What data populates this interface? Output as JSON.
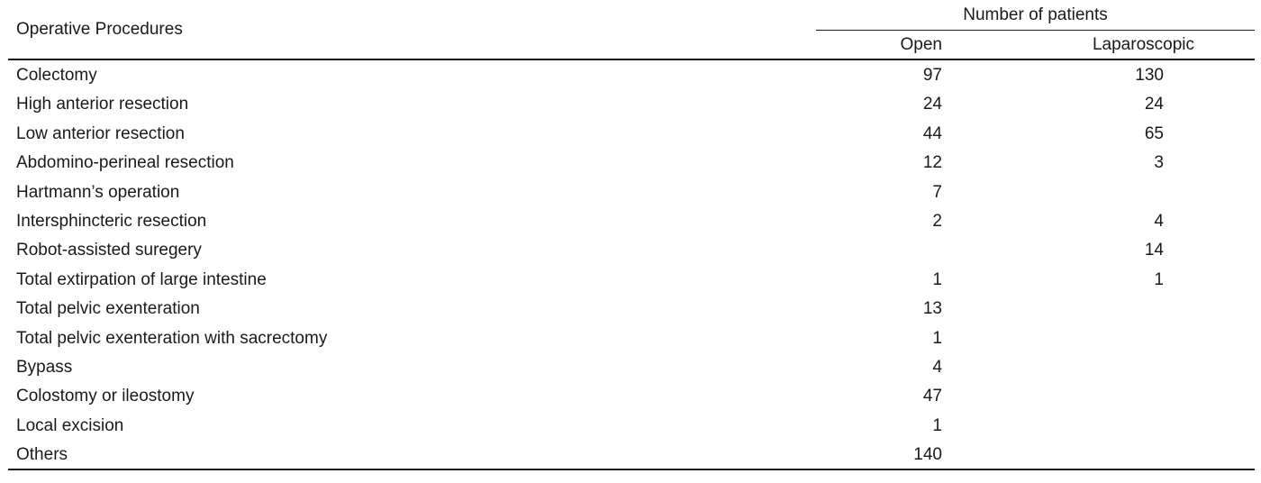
{
  "table": {
    "header": {
      "procedure_label": "Operative Procedures",
      "group_label": "Number of patients",
      "columns": [
        "Open",
        "Laparoscopic"
      ]
    },
    "rows": [
      {
        "procedure": "Colectomy",
        "open": "97",
        "laparoscopic": "130"
      },
      {
        "procedure": "High anterior resection",
        "open": "24",
        "laparoscopic": "24"
      },
      {
        "procedure": "Low anterior resection",
        "open": "44",
        "laparoscopic": "65"
      },
      {
        "procedure": "Abdomino-perineal resection",
        "open": "12",
        "laparoscopic": "3"
      },
      {
        "procedure": "Hartmann’s operation",
        "open": "7",
        "laparoscopic": ""
      },
      {
        "procedure": "Intersphincteric resection",
        "open": "2",
        "laparoscopic": "4"
      },
      {
        "procedure": "Robot-assisted suregery",
        "open": "",
        "laparoscopic": "14"
      },
      {
        "procedure": "Total extirpation of large intestine",
        "open": "1",
        "laparoscopic": "1"
      },
      {
        "procedure": "Total pelvic exenteration",
        "open": "13",
        "laparoscopic": ""
      },
      {
        "procedure": "Total pelvic exenteration with sacrectomy",
        "open": "1",
        "laparoscopic": ""
      },
      {
        "procedure": "Bypass",
        "open": "4",
        "laparoscopic": ""
      },
      {
        "procedure": "Colostomy or ileostomy",
        "open": "47",
        "laparoscopic": ""
      },
      {
        "procedure": "Local excision",
        "open": "1",
        "laparoscopic": ""
      },
      {
        "procedure": "Others",
        "open": "140",
        "laparoscopic": ""
      }
    ]
  }
}
